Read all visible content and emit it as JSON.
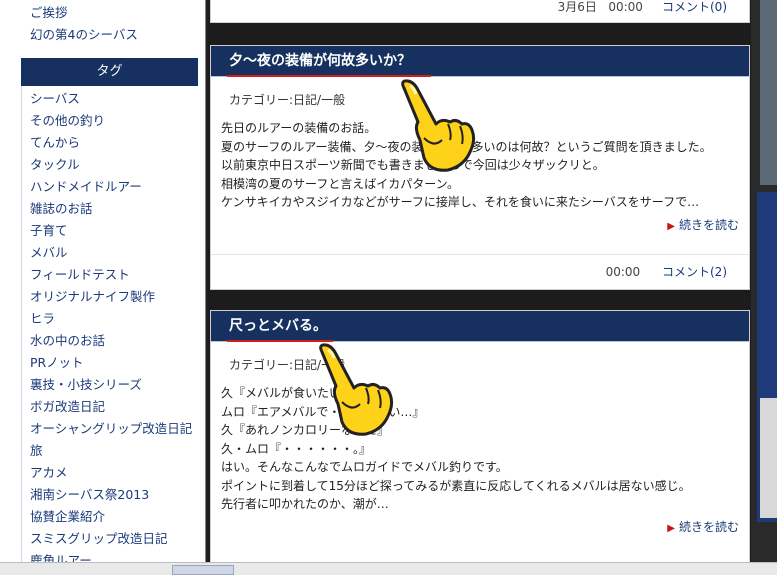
{
  "sidebar": {
    "top_links": [
      "ご挨拶",
      "幻の第4のシーバス"
    ],
    "tag_header": "タグ",
    "tags": [
      "シーバス",
      "その他の釣り",
      "てんから",
      "タックル",
      "ハンドメイドルアー",
      "雑誌のお話",
      "子育て",
      "メバル",
      "フィールドテスト",
      "オリジナルナイフ製作",
      "ヒラ",
      "水の中のお話",
      "PRノット",
      "裏技・小技シリーズ",
      "ボガ改造日記",
      "オーシャングリップ改造日記",
      "旅",
      "アカメ",
      "湘南シーバス祭2013",
      "協賛企業紹介",
      "スミスグリップ改造日記",
      "鹿角ルアー"
    ]
  },
  "prev_post": {
    "date": "3月6日",
    "time": "00:00",
    "comment": "コメント(0)"
  },
  "posts": [
    {
      "title": "夕～夜の装備が何故多いか？",
      "category": "カテゴリー:日記/一般",
      "lines": [
        "先日のルアーの装備のお話。",
        "夏のサーフのルアー装備、夕～夜の装備が少し多いのは何故？というご質問を頂きました。",
        "以前東京中日スポーツ新聞でも書きましたので今回は少々ザックリと。",
        "相模湾の夏のサーフと言えばイカパターン。",
        "ケンサキイカやスジイカなどがサーフに接岸し、それを食いに来たシーバスをサーフで…"
      ],
      "read_more": "続きを読む",
      "time": "00:00",
      "comment": "コメント(2)"
    },
    {
      "title": "尺っとメバる。",
      "category": "カテゴリー:日記/一般",
      "lines": [
        "久『メバルが食いたい・・・』",
        "ムロ『エアメバルで・・・・・い…』",
        "久『あれノンカロリーなんだ』",
        "久・ムロ『・・・・・・。』",
        "はい。そんなこんなでムロガイドでメバル釣りです。",
        "ポイントに到着して15分ほど探ってみるが素直に反応してくれるメバルは居ない感じ。",
        "先行者に叩かれたのか、潮が…"
      ],
      "read_more": "続きを読む"
    }
  ],
  "colors": {
    "header_navy": "#16305f",
    "accent_red": "#d31c1c",
    "link_blue": "#1a3a7a",
    "hand_yellow": "#ffd21a"
  },
  "icons": {
    "pointer": "pointing-hand-icon",
    "read_more": "triangle-right-icon"
  }
}
